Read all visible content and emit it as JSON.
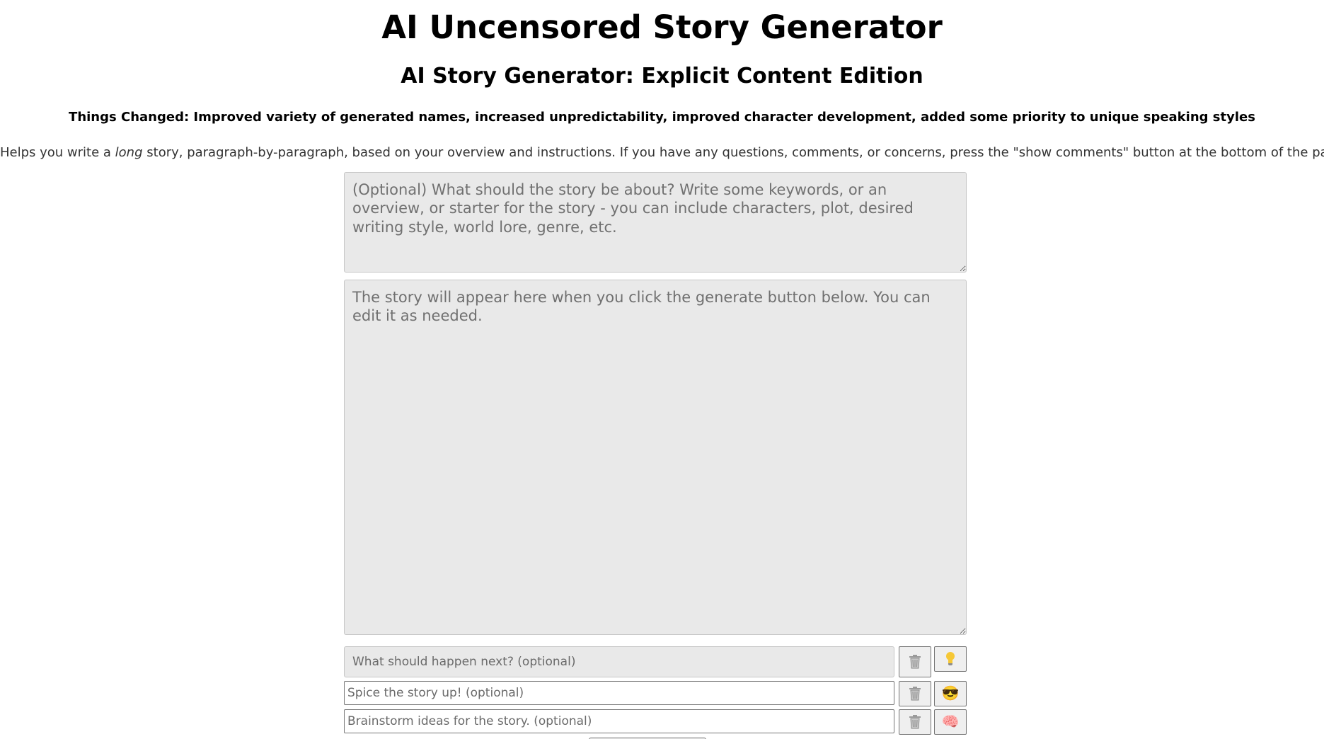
{
  "header": {
    "title": "AI Uncensored Story Generator",
    "subtitle": "AI Story Generator: Explicit Content Edition",
    "changes": "Things Changed: Improved variety of generated names, increased unpredictability, improved character development, added some priority to unique speaking styles",
    "intro_before": "Helps you write a ",
    "intro_emphasis": "long",
    "intro_after": " story, paragraph-by-paragraph, based on your overview and instructions. If you have any questions, comments, or concerns, press the \"show comments\" button at the bottom of the page."
  },
  "overview_input": {
    "value": "",
    "placeholder": "(Optional) What should the story be about? Write some keywords, or an overview, or starter for the story - you can include characters, plot, desired writing style, world lore, genre, etc."
  },
  "story_output": {
    "value": "",
    "placeholder": "The story will appear here when you click the generate button below. You can edit it as needed."
  },
  "instructions": [
    {
      "placeholder": "What should happen next? (optional)",
      "value": "",
      "clear_icon": "trash-icon",
      "action_icon": "lightbulb-icon"
    },
    {
      "placeholder": "Spice the story up! (optional)",
      "value": "",
      "clear_icon": "trash-icon",
      "action_icon": "smiling-face-with-sunglasses-icon",
      "action_glyph": "😎"
    },
    {
      "placeholder": "Brainstorm ideas for the story. (optional)",
      "value": "",
      "clear_icon": "trash-icon",
      "action_icon": "brain-icon",
      "action_glyph": "🧠"
    }
  ],
  "colors": {
    "field_background": "#e9e9e9",
    "button_background": "#efefef",
    "text": "#000000"
  }
}
